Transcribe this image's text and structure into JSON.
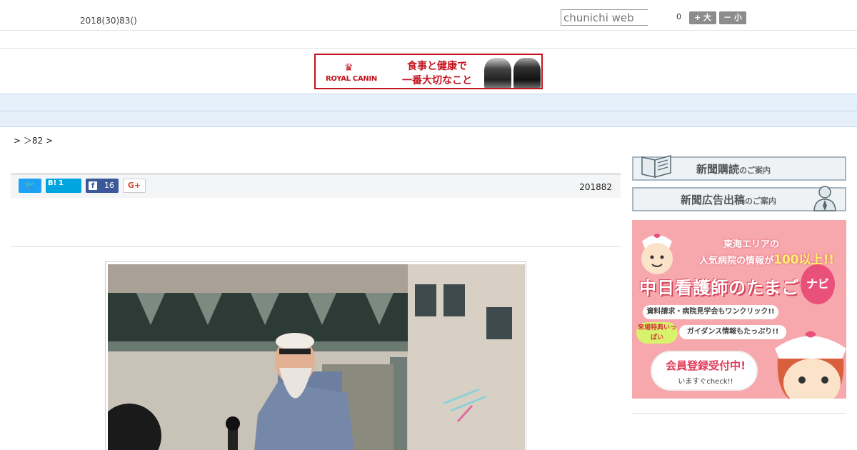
{
  "header": {
    "date": "2018(30)83()",
    "search_placeholder": "chunichi web",
    "font_size_indicator": "0",
    "font_size_up": "+ 大",
    "font_size_down": "－ 小"
  },
  "banner": {
    "brand": "ROYAL CANIN",
    "copy_line1": "食事と健康で",
    "copy_line2": "一番大切なこと",
    "color": "#c3141f"
  },
  "nav": {
    "items": [
      "",
      "",
      "",
      "",
      "",
      "",
      "",
      "",
      ""
    ],
    "background": "#e6f0fa"
  },
  "breadcrumb": {
    "text": "> ＞82 >"
  },
  "share": {
    "twitter_icon": "twitter-icon",
    "hatena_mark": "B!",
    "hatena_count": "1",
    "facebook_count": "16",
    "gplus_label": "G+",
    "article_date": "201882"
  },
  "sidebar": {
    "subscribe_label": "新聞購読",
    "subscribe_suffix": "のご案内",
    "ad_label": "新聞広告出稿",
    "ad_suffix": "のご案内",
    "nurse_ad": {
      "line1": "東海エリアの",
      "line2_pre": "人気病院の情報が",
      "line2_num": "100以上!!",
      "title": "中日看護師のたまご",
      "navi": "ナビ",
      "bullet1": "資料請求・病院見学会もワンクリック!!",
      "bullet2": "ガイダンス情報もたっぷり!!",
      "tokuten": "来場特典いっぱい",
      "register": "会員登録受付中!",
      "check": "いますぐcheck!!",
      "background": "#f7a8ad"
    }
  }
}
